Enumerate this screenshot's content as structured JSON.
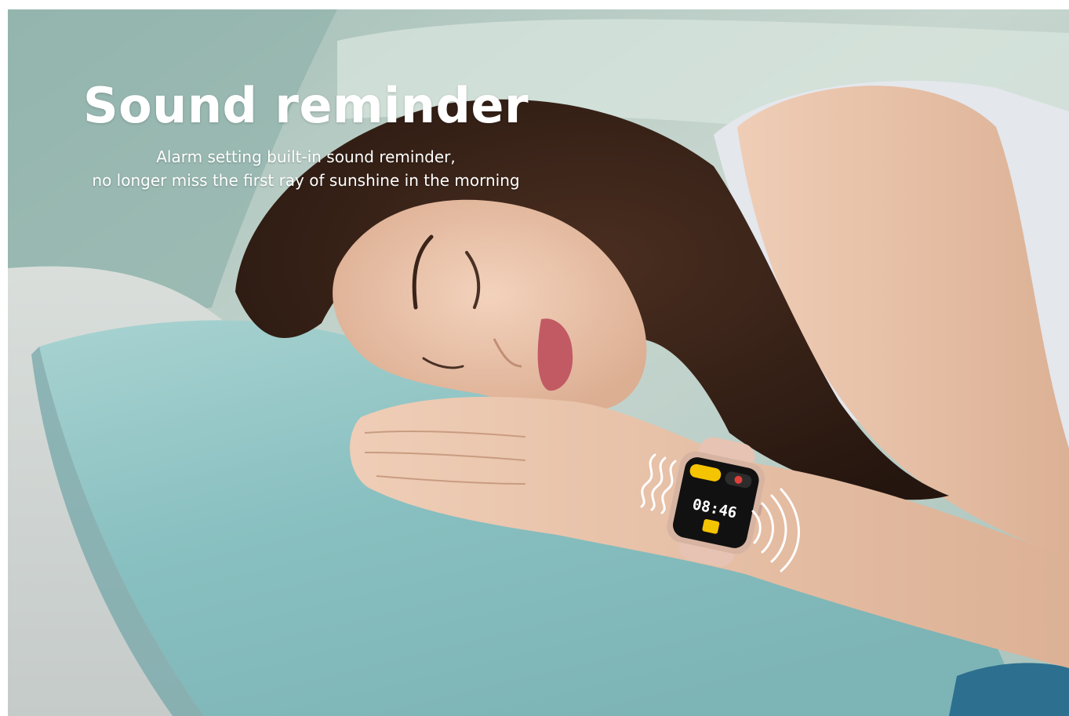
{
  "headline": "Sound reminder",
  "subtitle_line1": "Alarm setting built-in sound reminder,",
  "subtitle_line2": "no longer miss the first ray of sunshine in the morning",
  "watch": {
    "time_display": "08:46",
    "screen_color": "#111111",
    "button_color": "#f5c400",
    "dismiss_color": "#e0403a"
  },
  "colors": {
    "pillow": "#8fc3c4",
    "background": "#b9cdc6",
    "hair": "#3a2419",
    "skin": "#e9c2a8",
    "top": "#e8eaee"
  },
  "icons": [
    "vibration-wave-icon",
    "sound-wave-icon",
    "alarm-bell-icon"
  ]
}
